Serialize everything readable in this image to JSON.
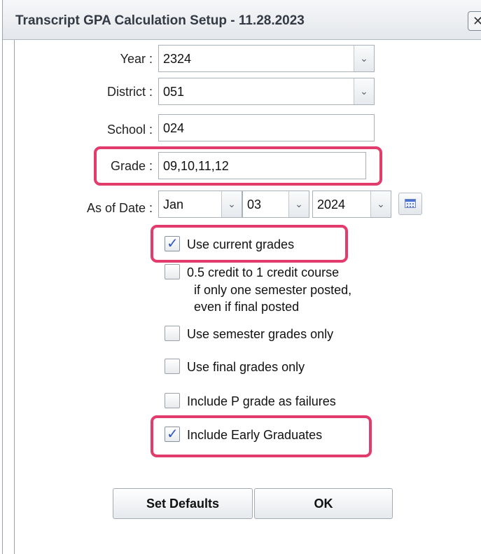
{
  "dialog": {
    "title": "Transcript GPA Calculation Setup - 11.28.2023",
    "close_icon": "close-icon"
  },
  "form": {
    "year": {
      "label": "Year :",
      "value": "2324"
    },
    "district": {
      "label": "District :",
      "value": "051"
    },
    "school": {
      "label": "School :",
      "value": "024"
    },
    "grade": {
      "label": "Grade :",
      "value": "09,10,11,12"
    },
    "as_of_date": {
      "label": "As of Date :",
      "month": "Jan",
      "day": "03",
      "year": "2024",
      "calendar_icon": "calendar-icon"
    }
  },
  "options": [
    {
      "label": "Use current grades",
      "checked": true
    },
    {
      "line1": "0.5 credit to 1 credit course",
      "line2": "if only one semester posted,",
      "line3": "even if final posted",
      "checked": false
    },
    {
      "label": "Use semester grades only",
      "checked": false
    },
    {
      "label": "Use final grades only",
      "checked": false
    },
    {
      "label": "Include P grade as failures",
      "checked": false
    },
    {
      "label": "Include Early Graduates",
      "checked": true
    }
  ],
  "buttons": {
    "set_defaults": "Set Defaults",
    "ok": "OK"
  },
  "highlight_color": "#e23c6d",
  "checkmark_color": "#2f56c7"
}
